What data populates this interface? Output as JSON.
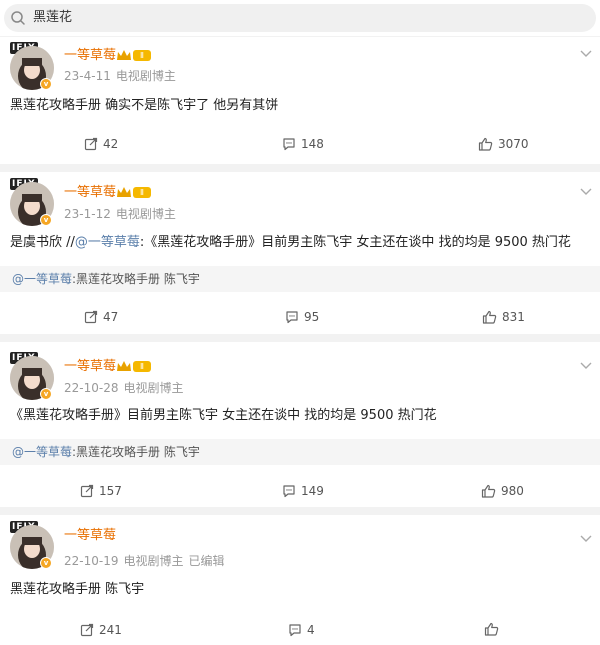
{
  "search": {
    "query": "黑莲花"
  },
  "posts": [
    {
      "username": "一等草莓",
      "level": "Ⅱ",
      "logo": "IFIX",
      "date": "23-4-11",
      "role": "电视剧博主",
      "edited": "",
      "body_prefix": "黑莲花攻略手册 确实不是陈飞宇了 他另有其饼",
      "body_link": "",
      "body_suffix": "",
      "repost_author": "",
      "repost_text": "",
      "reposts": "42",
      "comments": "148",
      "likes": "3070"
    },
    {
      "username": "一等草莓",
      "level": "Ⅱ",
      "logo": "IFIX",
      "date": "23-1-12",
      "role": "电视剧博主",
      "edited": "",
      "body_prefix": "是虞书欣 //",
      "body_link": "@一等草莓",
      "body_suffix": ":《黑莲花攻略手册》目前男主陈飞宇   女主还在谈中 找的均是 9500 热门花",
      "repost_author": "@一等草莓",
      "repost_text": ":黑莲花攻略手册 陈飞宇",
      "reposts": "47",
      "comments": "95",
      "likes": "831"
    },
    {
      "username": "一等草莓",
      "level": "Ⅱ",
      "logo": "IFIX",
      "date": "22-10-28",
      "role": "电视剧博主",
      "edited": "",
      "body_prefix": "《黑莲花攻略手册》目前男主陈飞宇   女主还在谈中 找的均是 9500 热门花",
      "body_link": "",
      "body_suffix": "",
      "repost_author": "@一等草莓",
      "repost_text": ":黑莲花攻略手册 陈飞宇",
      "reposts": "157",
      "comments": "149",
      "likes": "980"
    },
    {
      "username": "一等草莓",
      "level": "Ⅱ",
      "logo": "IFIX",
      "date": "22-10-19",
      "role": "电视剧博主",
      "edited": "已编辑",
      "body_prefix": "黑莲花攻略手册 陈飞宇",
      "body_link": "",
      "body_suffix": "",
      "repost_author": "",
      "repost_text": "",
      "reposts": "241",
      "comments": "4",
      "likes": ""
    }
  ],
  "colors": {
    "username": "#e86f00",
    "link": "#5b7faa",
    "meta": "#999999",
    "badge": "#f5a623"
  },
  "icons": {
    "search": "search-icon",
    "repost": "repost-icon",
    "comment": "comment-icon",
    "like": "thumbs-up-icon",
    "more": "chevron-down-icon"
  }
}
